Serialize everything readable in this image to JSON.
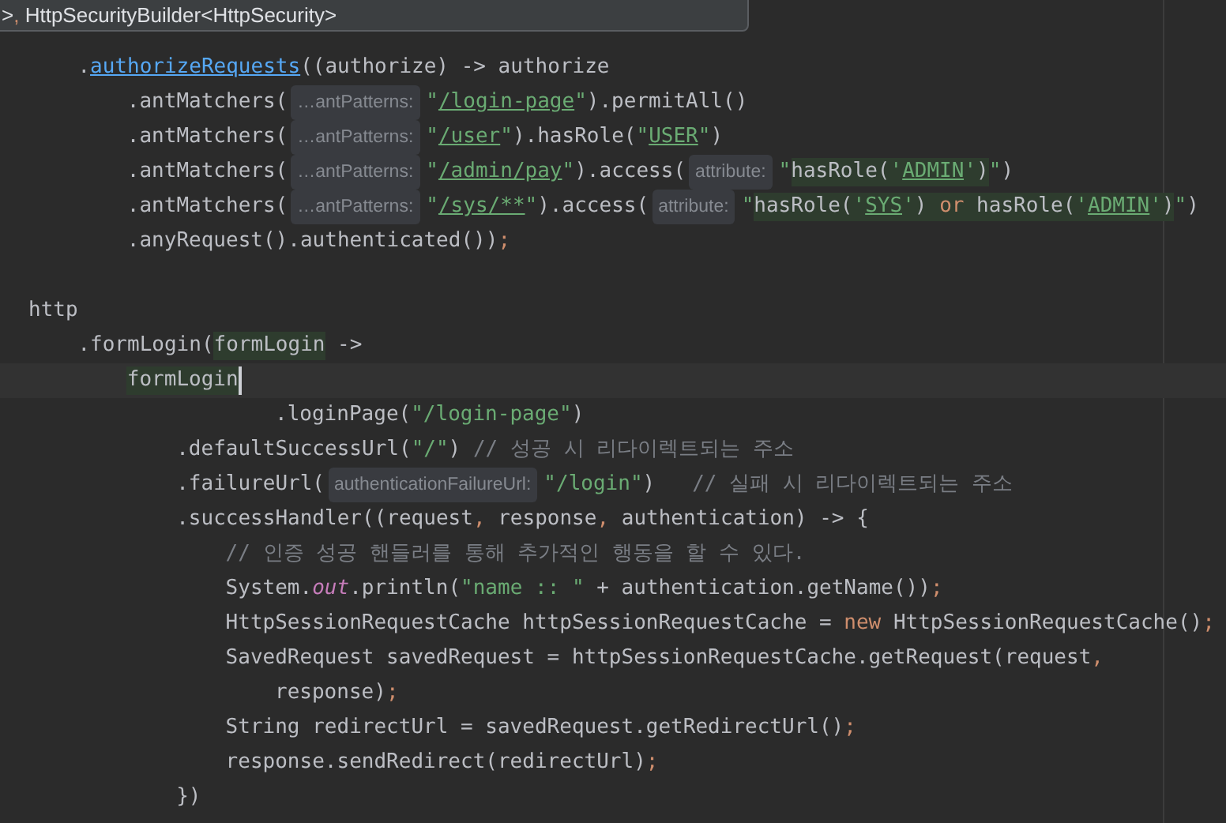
{
  "tooltip": {
    "tokens": [
      {
        "kind": "plain",
        "text": ">"
      },
      {
        "kind": "punct",
        "text": ","
      },
      {
        "kind": "plain",
        "text": " HttpSecurityBuilder<HttpSecurity>"
      }
    ]
  },
  "lines": [
    {
      "kind": "chain",
      "current": false,
      "tokens": [
        {
          "kind": "plain",
          "text": "."
        },
        {
          "kind": "link",
          "text": "authorizeRequests"
        },
        {
          "kind": "plain",
          "text": "((authorize) -> authorize"
        }
      ]
    },
    {
      "kind": "nested",
      "current": false,
      "tokens": [
        {
          "kind": "plain",
          "text": ".antMatchers("
        },
        {
          "kind": "hint",
          "text": "…antPatterns:"
        },
        {
          "kind": "string",
          "text": "\""
        },
        {
          "kind": "stringlink",
          "text": "/login-page"
        },
        {
          "kind": "string",
          "text": "\""
        },
        {
          "kind": "plain",
          "text": ").permitAll()"
        }
      ]
    },
    {
      "kind": "nested",
      "current": false,
      "tokens": [
        {
          "kind": "plain",
          "text": ".antMatchers("
        },
        {
          "kind": "hint",
          "text": "…antPatterns:"
        },
        {
          "kind": "string",
          "text": "\""
        },
        {
          "kind": "stringlink",
          "text": "/user"
        },
        {
          "kind": "string",
          "text": "\""
        },
        {
          "kind": "plain",
          "text": ").hasRole("
        },
        {
          "kind": "string",
          "text": "\""
        },
        {
          "kind": "stringlink",
          "text": "USER"
        },
        {
          "kind": "string",
          "text": "\""
        },
        {
          "kind": "plain",
          "text": ")"
        }
      ]
    },
    {
      "kind": "nested",
      "current": false,
      "tokens": [
        {
          "kind": "plain",
          "text": ".antMatchers("
        },
        {
          "kind": "hint",
          "text": "…antPatterns:"
        },
        {
          "kind": "string",
          "text": "\""
        },
        {
          "kind": "stringlink",
          "text": "/admin/pay"
        },
        {
          "kind": "string",
          "text": "\""
        },
        {
          "kind": "plain",
          "text": ").access("
        },
        {
          "kind": "hint",
          "text": "attribute:"
        },
        {
          "kind": "string",
          "text": "\""
        },
        {
          "kind": "marked",
          "text": "hasRole("
        },
        {
          "kind": "markedstring",
          "text": "'"
        },
        {
          "kind": "markedlink",
          "text": "ADMIN"
        },
        {
          "kind": "markedstring",
          "text": "'"
        },
        {
          "kind": "marked",
          "text": ")"
        },
        {
          "kind": "string",
          "text": "\""
        },
        {
          "kind": "plain",
          "text": ")"
        }
      ]
    },
    {
      "kind": "nested",
      "current": false,
      "tokens": [
        {
          "kind": "plain",
          "text": ".antMatchers("
        },
        {
          "kind": "hint",
          "text": "…antPatterns:"
        },
        {
          "kind": "string",
          "text": "\""
        },
        {
          "kind": "stringlink",
          "text": "/sys/**"
        },
        {
          "kind": "string",
          "text": "\""
        },
        {
          "kind": "plain",
          "text": ").access("
        },
        {
          "kind": "hint",
          "text": "attribute:"
        },
        {
          "kind": "string",
          "text": "\""
        },
        {
          "kind": "marked",
          "text": "hasRole("
        },
        {
          "kind": "markedstring",
          "text": "'"
        },
        {
          "kind": "markedlink",
          "text": "SYS"
        },
        {
          "kind": "markedstring",
          "text": "'"
        },
        {
          "kind": "marked",
          "text": ") "
        },
        {
          "kind": "markedkeyword",
          "text": "or"
        },
        {
          "kind": "marked",
          "text": " hasRole("
        },
        {
          "kind": "markedstring",
          "text": "'"
        },
        {
          "kind": "markedlink",
          "text": "ADMIN"
        },
        {
          "kind": "markedstring",
          "text": "'"
        },
        {
          "kind": "marked",
          "text": ")"
        },
        {
          "kind": "string",
          "text": "\""
        },
        {
          "kind": "plain",
          "text": ")"
        }
      ]
    },
    {
      "kind": "nested",
      "current": false,
      "tokens": [
        {
          "kind": "plain",
          "text": ".anyRequest().authenticated())"
        },
        {
          "kind": "punct",
          "text": ";"
        }
      ]
    },
    {
      "kind": "blank",
      "current": false
    },
    {
      "kind": "top",
      "current": false,
      "tokens": [
        {
          "kind": "plain",
          "text": "http"
        }
      ]
    },
    {
      "kind": "chain",
      "current": false,
      "tokens": [
        {
          "kind": "plain",
          "text": ".formLogin("
        },
        {
          "kind": "marked",
          "text": "formLogin"
        },
        {
          "kind": "plain",
          "text": " ->"
        }
      ]
    },
    {
      "kind": "nested",
      "current": true,
      "tokens": [
        {
          "kind": "marked",
          "text": "formLogin"
        }
      ]
    },
    {
      "kind": "continuation",
      "current": false,
      "tokens": [
        {
          "kind": "plain",
          "text": ".loginPage("
        },
        {
          "kind": "string",
          "text": "\"/login-page\""
        },
        {
          "kind": "plain",
          "text": ")"
        }
      ]
    },
    {
      "kind": "handler",
      "current": false,
      "tokens": [
        {
          "kind": "plain",
          "text": ".defaultSuccessUrl("
        },
        {
          "kind": "string",
          "text": "\"/\""
        },
        {
          "kind": "plain",
          "text": ") "
        },
        {
          "kind": "comment",
          "text": "// 성공 시 리다이렉트되는 주소"
        }
      ]
    },
    {
      "kind": "handler",
      "current": false,
      "tokens": [
        {
          "kind": "plain",
          "text": ".failureUrl("
        },
        {
          "kind": "hint",
          "text": "authenticationFailureUrl:"
        },
        {
          "kind": "string",
          "text": "\"/login\""
        },
        {
          "kind": "plain",
          "text": ")   "
        },
        {
          "kind": "comment",
          "text": "// 실패 시 리다이렉트되는 주소"
        }
      ]
    },
    {
      "kind": "handler",
      "current": false,
      "tokens": [
        {
          "kind": "plain",
          "text": ".successHandler((request"
        },
        {
          "kind": "punct",
          "text": ","
        },
        {
          "kind": "plain",
          "text": " response"
        },
        {
          "kind": "punct",
          "text": ","
        },
        {
          "kind": "plain",
          "text": " authentication) -> {"
        }
      ]
    },
    {
      "kind": "body",
      "current": false,
      "tokens": [
        {
          "kind": "comment",
          "text": "// 인증 성공 핸들러를 통해 추가적인 행동을 할 수 있다."
        }
      ]
    },
    {
      "kind": "body",
      "current": false,
      "tokens": [
        {
          "kind": "plain",
          "text": "System."
        },
        {
          "kind": "field",
          "text": "out"
        },
        {
          "kind": "plain",
          "text": ".println("
        },
        {
          "kind": "string",
          "text": "\"name :: \""
        },
        {
          "kind": "plain",
          "text": " + authentication.getName())"
        },
        {
          "kind": "punct",
          "text": ";"
        }
      ]
    },
    {
      "kind": "body",
      "current": false,
      "tokens": [
        {
          "kind": "plain",
          "text": "HttpSessionRequestCache httpSessionRequestCache = "
        },
        {
          "kind": "keyword",
          "text": "new"
        },
        {
          "kind": "plain",
          "text": " HttpSessionRequestCache()"
        },
        {
          "kind": "punct",
          "text": ";"
        }
      ]
    },
    {
      "kind": "body",
      "current": false,
      "tokens": [
        {
          "kind": "plain",
          "text": "SavedRequest savedRequest = httpSessionRequestCache.getRequest(request"
        },
        {
          "kind": "punct",
          "text": ","
        }
      ]
    },
    {
      "kind": "continuation",
      "current": false,
      "tokens": [
        {
          "kind": "plain",
          "text": "response)"
        },
        {
          "kind": "punct",
          "text": ";"
        }
      ]
    },
    {
      "kind": "body",
      "current": false,
      "tokens": [
        {
          "kind": "plain",
          "text": "String redirectUrl = savedRequest.getRedirectUrl()"
        },
        {
          "kind": "punct",
          "text": ";"
        }
      ]
    },
    {
      "kind": "body",
      "current": false,
      "tokens": [
        {
          "kind": "plain",
          "text": "response.sendRedirect(redirectUrl)"
        },
        {
          "kind": "punct",
          "text": ";"
        }
      ]
    },
    {
      "kind": "handler",
      "current": false,
      "tokens": [
        {
          "kind": "plain",
          "text": "})"
        }
      ]
    }
  ]
}
